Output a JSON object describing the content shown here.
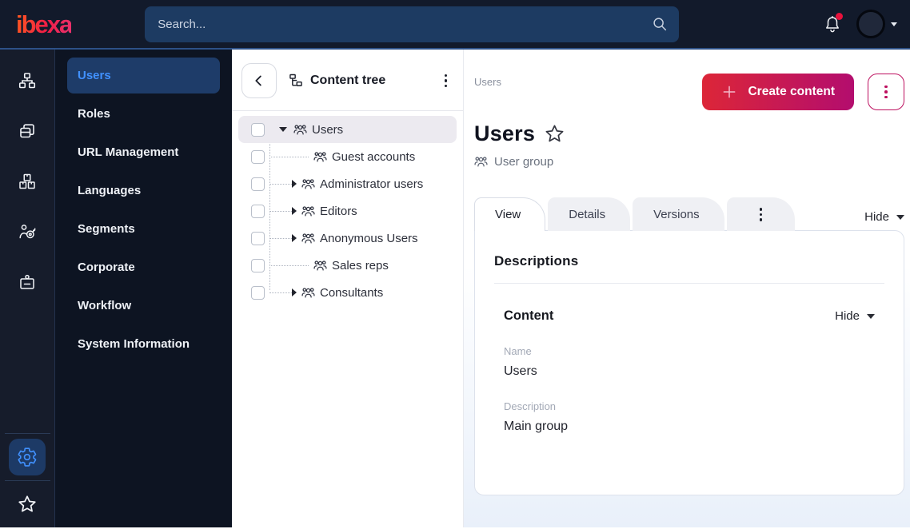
{
  "colors": {
    "accent_blue": "#4191ff",
    "brand_gradient_start": "#dc2638",
    "brand_gradient_end": "#b30d6e",
    "notification_dot": "#e8113c",
    "topbar_bg": "#121a2b",
    "sidebar_bg": "#0d1422",
    "active_menu_item_bg": "#1e3c69",
    "tree_selected_row_bg": "#eceaf0"
  },
  "topbar": {
    "logo_text": "ibexa",
    "search": {
      "placeholder": "Search...",
      "value": "",
      "icon": "search-icon"
    },
    "notifications": {
      "icon": "bell-icon",
      "has_unread": true
    },
    "user_menu": {
      "icon": "avatar",
      "caret_icon": "chevron-down-icon"
    }
  },
  "rail": {
    "items": [
      {
        "icon": "sitemap-icon"
      },
      {
        "icon": "content-pages-icon"
      },
      {
        "icon": "product-boxes-icon"
      },
      {
        "icon": "audience-target-icon"
      },
      {
        "icon": "id-badge-icon"
      }
    ],
    "bottom_items": [
      {
        "icon": "settings-gear-icon",
        "active": true
      },
      {
        "icon": "bookmarks-star-icon",
        "active": false
      }
    ]
  },
  "sidebar": {
    "items": [
      {
        "label": "Users",
        "active": true
      },
      {
        "label": "Roles",
        "active": false
      },
      {
        "label": "URL Management",
        "active": false
      },
      {
        "label": "Languages",
        "active": false
      },
      {
        "label": "Segments",
        "active": false
      },
      {
        "label": "Corporate",
        "active": false
      },
      {
        "label": "Workflow",
        "active": false
      },
      {
        "label": "System Information",
        "active": false
      }
    ]
  },
  "content_tree": {
    "title": "Content tree",
    "collapse_icon": "chevron-left-icon",
    "menu_icon": "kebab-menu-icon",
    "rows": [
      {
        "label": "Users",
        "icon": "user-group-icon",
        "depth": 0,
        "expanded": true,
        "selected": true
      },
      {
        "label": "Guest accounts",
        "icon": "user-group-icon",
        "depth": 1,
        "has_children": false,
        "selected": false
      },
      {
        "label": "Administrator users",
        "icon": "user-group-icon",
        "depth": 1,
        "has_children": true,
        "selected": false
      },
      {
        "label": "Editors",
        "icon": "user-group-icon",
        "depth": 1,
        "has_children": true,
        "selected": false
      },
      {
        "label": "Anonymous Users",
        "icon": "user-group-icon",
        "depth": 1,
        "has_children": true,
        "selected": false
      },
      {
        "label": "Sales reps",
        "icon": "user-group-icon",
        "depth": 1,
        "has_children": false,
        "selected": false
      },
      {
        "label": "Consultants",
        "icon": "user-group-icon",
        "depth": 1,
        "has_children": true,
        "selected": false
      }
    ]
  },
  "main": {
    "breadcrumb": "Users",
    "create_button": {
      "label": "Create content",
      "icon": "plus-icon"
    },
    "actions_menu_icon": "kebab-menu-icon",
    "title": "Users",
    "title_star_icon": "star-icon",
    "content_type": {
      "label": "User group",
      "icon": "user-group-icon"
    },
    "tabs": [
      {
        "label": "View",
        "active": true
      },
      {
        "label": "Details",
        "active": false
      },
      {
        "label": "Versions",
        "active": false
      }
    ],
    "tabs_more_icon": "kebab-menu-icon",
    "hide_toggle": {
      "label": "Hide",
      "icon": "caret-down-icon"
    },
    "card": {
      "heading": "Descriptions",
      "section": {
        "heading": "Content",
        "hide_toggle": {
          "label": "Hide",
          "icon": "caret-down-icon"
        },
        "fields": [
          {
            "label": "Name",
            "value": "Users"
          },
          {
            "label": "Description",
            "value": "Main group"
          }
        ]
      }
    }
  }
}
